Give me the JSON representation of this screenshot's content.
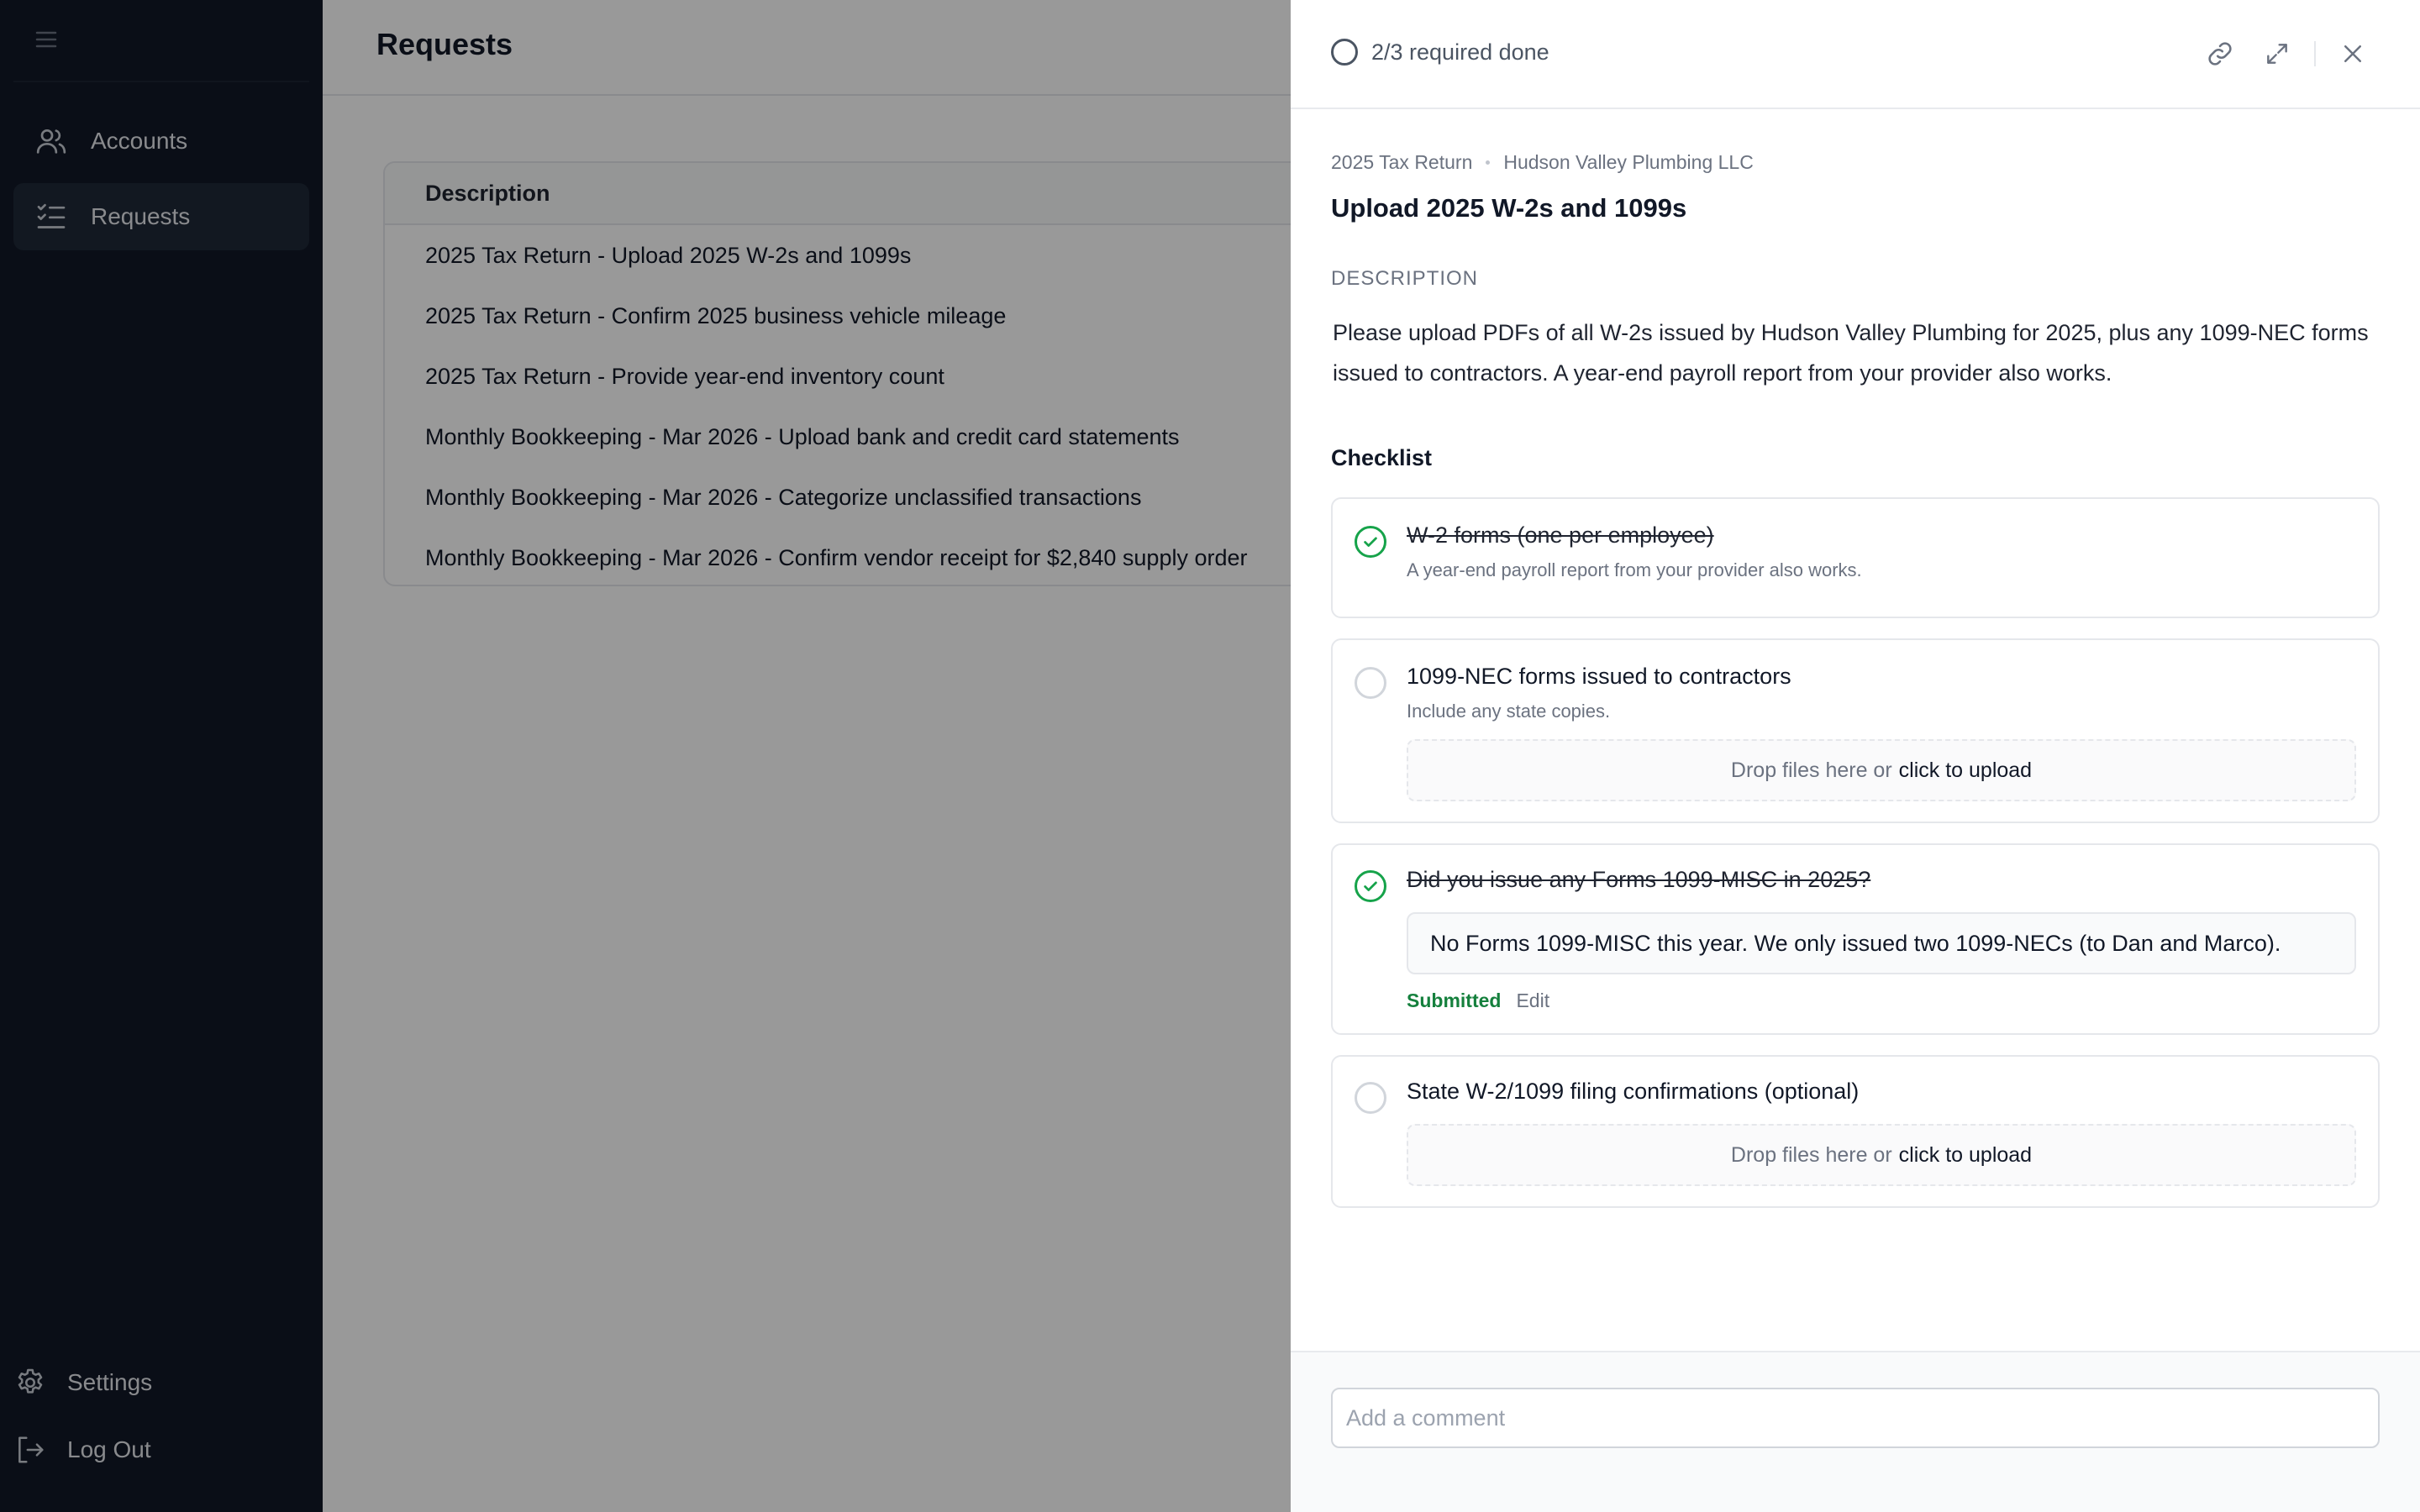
{
  "sidebar": {
    "items": [
      {
        "label": "Accounts",
        "icon": "users-icon"
      },
      {
        "label": "Requests",
        "icon": "checklist-icon"
      }
    ],
    "bottom": [
      {
        "label": "Settings",
        "icon": "gear-icon"
      },
      {
        "label": "Log Out",
        "icon": "logout-icon"
      }
    ]
  },
  "main": {
    "title": "Requests",
    "table": {
      "header": "Description",
      "rows": [
        "2025 Tax Return - Upload 2025 W-2s and 1099s",
        "2025 Tax Return - Confirm 2025 business vehicle mileage",
        "2025 Tax Return - Provide year-end inventory count",
        "Monthly Bookkeeping - Mar 2026 - Upload bank and credit card statements",
        "Monthly Bookkeeping - Mar 2026 - Categorize unclassified transactions",
        "Monthly Bookkeeping - Mar 2026 - Confirm vendor receipt for $2,840 supply order"
      ]
    }
  },
  "drawer": {
    "progress": "2/3 required done",
    "breadcrumb": [
      "2025 Tax Return",
      "Hudson Valley Plumbing LLC"
    ],
    "title": "Upload 2025 W-2s and 1099s",
    "description_label": "DESCRIPTION",
    "description": "Please upload PDFs of all W-2s issued by Hudson Valley Plumbing for 2025, plus any 1099-NEC forms issued to contractors. A year-end payroll report from your provider also works.",
    "checklist_title": "Checklist",
    "checklist": [
      {
        "title": "W-2 forms (one per employee)",
        "subtitle": "A year-end payroll report from your provider also works.",
        "done": true
      },
      {
        "title": "1099-NEC forms issued to contractors",
        "subtitle": "Include any state copies.",
        "done": false
      },
      {
        "title": "Did you issue any Forms 1099-MISC in 2025?",
        "answer": "No Forms 1099-MISC this year. We only issued two 1099-NECs (to Dan and Marco).",
        "status": "Submitted",
        "edit": "Edit",
        "done": true
      },
      {
        "title": "State W-2/1099 filing confirmations (optional)",
        "done": false
      }
    ],
    "dropzone_text": "Drop files here or",
    "dropzone_link": "click to upload",
    "comment_placeholder": "Add a comment"
  },
  "colors": {
    "sidebar_bg": "#111827",
    "success": "#16a34a",
    "overlay": "rgba(0,0,0,0.4)"
  }
}
